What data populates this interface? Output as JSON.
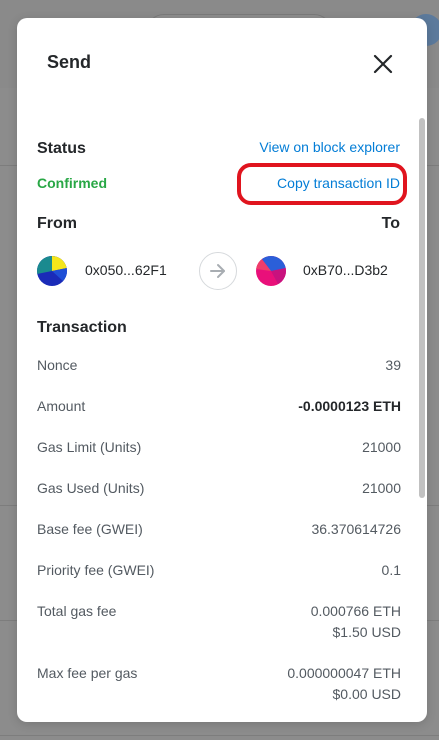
{
  "modal": {
    "title": "Send"
  },
  "status": {
    "heading": "Status",
    "value": "Confirmed",
    "value_color": "#28a745",
    "explorer_link": "View on block explorer",
    "copy_link": "Copy transaction ID"
  },
  "addresses": {
    "from_label": "From",
    "to_label": "To",
    "from_address": "0x050...62F1",
    "to_address": "0xB70...D3b2"
  },
  "transaction": {
    "heading": "Transaction",
    "rows": [
      {
        "label": "Nonce",
        "value": "39"
      },
      {
        "label": "Amount",
        "value": "-0.0000123 ETH"
      },
      {
        "label": "Gas Limit (Units)",
        "value": "21000"
      },
      {
        "label": "Gas Used (Units)",
        "value": "21000"
      },
      {
        "label": "Base fee (GWEI)",
        "value": "36.370614726"
      },
      {
        "label": "Priority fee (GWEI)",
        "value": "0.1"
      },
      {
        "label": "Total gas fee",
        "value": "0.000766 ETH",
        "value_secondary": "$1.50 USD"
      },
      {
        "label": "Max fee per gas",
        "value": "0.000000047 ETH",
        "value_secondary": "$0.00 USD"
      }
    ]
  },
  "colors": {
    "link": "#037dd6",
    "highlight": "#e0141e"
  },
  "icons": {
    "close": "close-icon",
    "arrow": "arrow-right-icon"
  }
}
